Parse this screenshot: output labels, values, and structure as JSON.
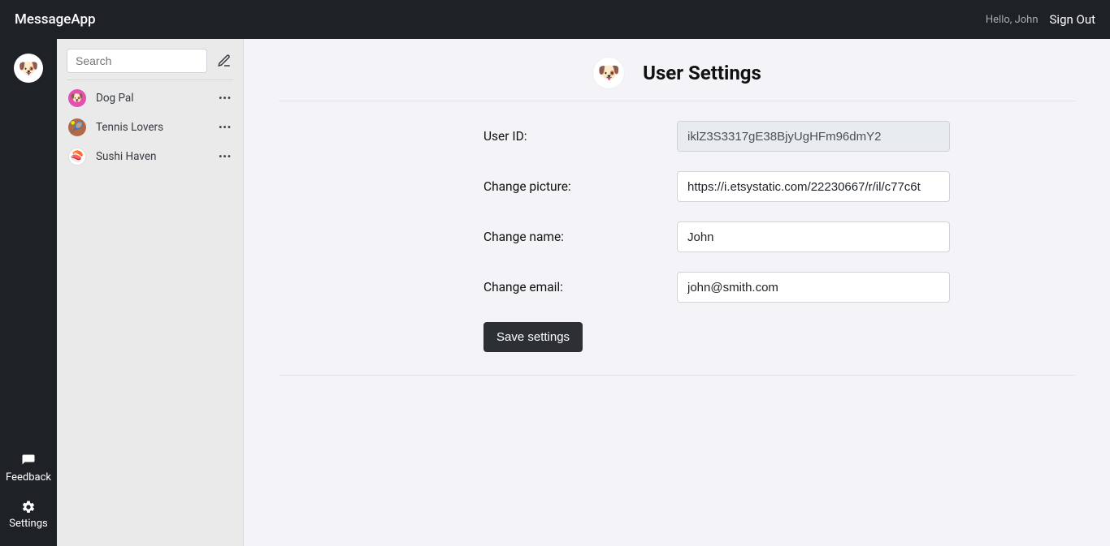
{
  "app": {
    "name": "MessageApp"
  },
  "header": {
    "greeting": "Hello, John",
    "signout_label": "Sign Out"
  },
  "rail": {
    "feedback_label": "Feedback",
    "settings_label": "Settings"
  },
  "chats": {
    "search_placeholder": "Search",
    "items": [
      {
        "name": "Dog Pal",
        "avatar_emoji": "🐶",
        "avatar_bg": "#e54fb0"
      },
      {
        "name": "Tennis Lovers",
        "avatar_emoji": "🎾",
        "avatar_bg": "#b06a4a"
      },
      {
        "name": "Sushi Haven",
        "avatar_emoji": "🍣",
        "avatar_bg": "#ffffff"
      }
    ]
  },
  "settings": {
    "title": "User Settings",
    "labels": {
      "user_id": "User ID:",
      "picture": "Change picture:",
      "name": "Change name:",
      "email": "Change email:"
    },
    "values": {
      "user_id": "iklZ3S3317gE38BjyUgHFm96dmY2",
      "picture": "https://i.etsystatic.com/22230667/r/il/c77c6t",
      "name": "John",
      "email": "john@smith.com"
    },
    "save_label": "Save settings"
  }
}
